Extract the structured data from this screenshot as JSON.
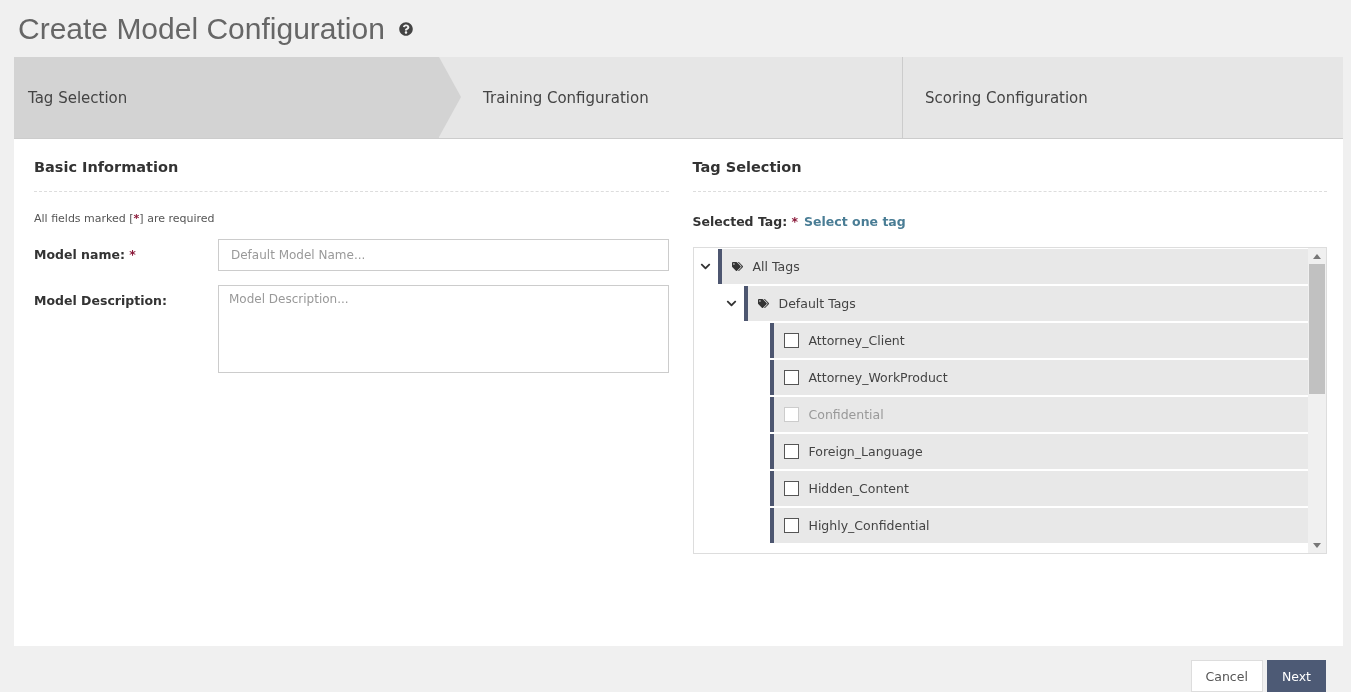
{
  "page_title": "Create Model Configuration",
  "steps": [
    {
      "label": "Tag Selection",
      "selected": true
    },
    {
      "label": "Training Configuration",
      "selected": false
    },
    {
      "label": "Scoring Configuration",
      "selected": false
    }
  ],
  "required_mark": "*",
  "basic_information": {
    "heading": "Basic Information",
    "required_note": {
      "before": "All fields marked [",
      "mark": "*",
      "after": "] are required"
    },
    "fields": [
      {
        "label": "Model name:",
        "required": true,
        "kind": "input",
        "placeholder": "Default Model Name..."
      },
      {
        "label": "Model Description:",
        "required": false,
        "kind": "textarea",
        "placeholder": "Model Description..."
      }
    ]
  },
  "tag_selection": {
    "heading": "Tag Selection",
    "selected_tag_label": "Selected Tag:",
    "required": true,
    "selected_tag_value": "Select one tag",
    "tree": [
      {
        "label": "All Tags",
        "kind": "folder",
        "expanded": true,
        "children": [
          {
            "label": "Default Tags",
            "kind": "folder",
            "expanded": true,
            "children": [
              {
                "label": "Attorney_Client",
                "kind": "tag",
                "checked": false,
                "disabled": false
              },
              {
                "label": "Attorney_WorkProduct",
                "kind": "tag",
                "checked": false,
                "disabled": false
              },
              {
                "label": "Confidential",
                "kind": "tag",
                "checked": false,
                "disabled": true
              },
              {
                "label": "Foreign_Language",
                "kind": "tag",
                "checked": false,
                "disabled": false
              },
              {
                "label": "Hidden_Content",
                "kind": "tag",
                "checked": false,
                "disabled": false
              },
              {
                "label": "Highly_Confidential",
                "kind": "tag",
                "checked": false,
                "disabled": false
              }
            ]
          }
        ]
      }
    ]
  },
  "buttons": [
    {
      "label": "Cancel",
      "kind": "secondary"
    },
    {
      "label": "Next",
      "kind": "primary"
    }
  ]
}
